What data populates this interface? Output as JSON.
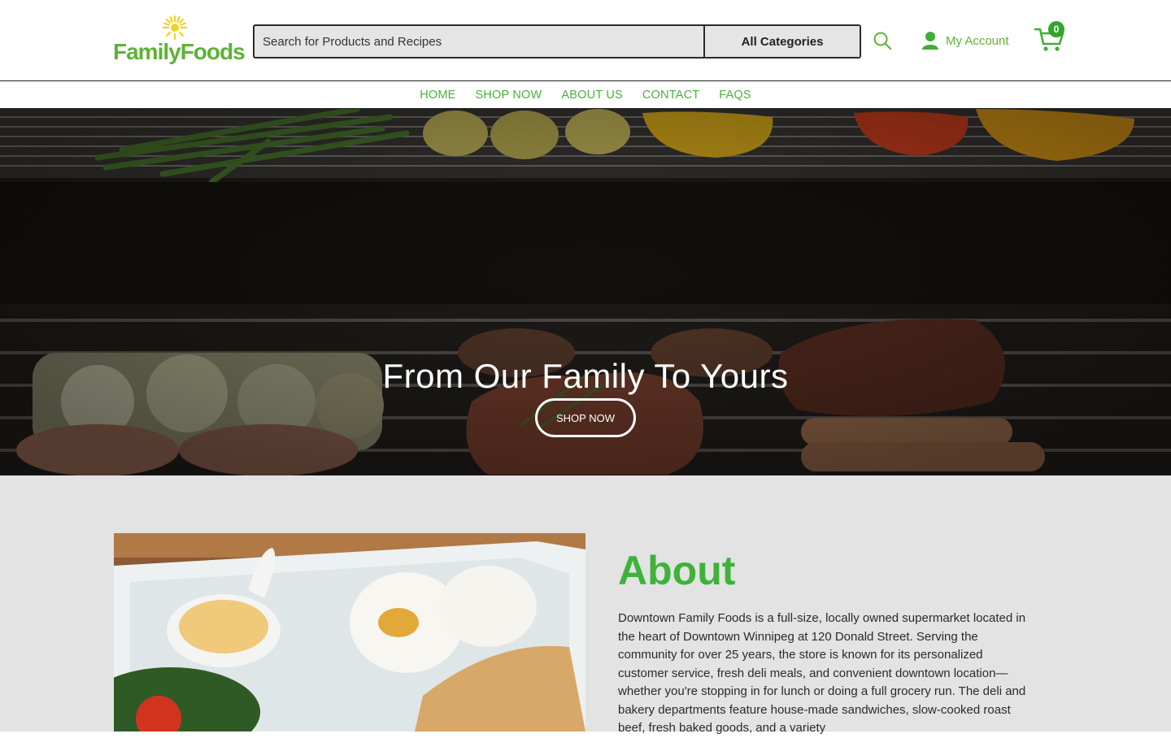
{
  "brand": {
    "name": "FamilyFoods",
    "color": "#5fb138",
    "accent": "#3fb23a"
  },
  "search": {
    "placeholder": "Search for Products and Recipes",
    "category_label": "All Categories"
  },
  "header": {
    "account_label": "My Account",
    "cart_count": "0"
  },
  "icons": {
    "search": "search-icon",
    "account": "user-icon",
    "cart": "cart-icon"
  },
  "nav": {
    "items": [
      "HOME",
      "SHOP NOW",
      "ABOUT US",
      "CONTACT",
      "FAQS"
    ]
  },
  "hero": {
    "title": "From Our Family To Yours",
    "button_label": "SHOP NOW"
  },
  "about": {
    "title": "About",
    "text": "Downtown Family Foods is a full-size, locally owned supermarket located in the heart of Downtown Winnipeg at 120 Donald Street. Serving the community for over 25 years, the store is known for its personalized customer service, fresh deli meals, and convenient downtown location—whether you're stopping in for lunch or doing a full grocery run. The deli and bakery departments feature house-made sandwiches, slow-cooked roast beef, fresh baked goods, and a variety"
  }
}
